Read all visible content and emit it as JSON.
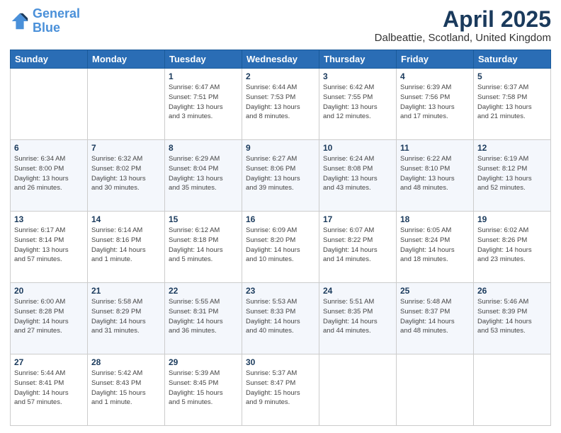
{
  "header": {
    "logo_line1": "General",
    "logo_line2": "Blue",
    "title": "April 2025",
    "subtitle": "Dalbeattie, Scotland, United Kingdom"
  },
  "days_of_week": [
    "Sunday",
    "Monday",
    "Tuesday",
    "Wednesday",
    "Thursday",
    "Friday",
    "Saturday"
  ],
  "weeks": [
    [
      {
        "num": "",
        "info": ""
      },
      {
        "num": "",
        "info": ""
      },
      {
        "num": "1",
        "info": "Sunrise: 6:47 AM\nSunset: 7:51 PM\nDaylight: 13 hours\nand 3 minutes."
      },
      {
        "num": "2",
        "info": "Sunrise: 6:44 AM\nSunset: 7:53 PM\nDaylight: 13 hours\nand 8 minutes."
      },
      {
        "num": "3",
        "info": "Sunrise: 6:42 AM\nSunset: 7:55 PM\nDaylight: 13 hours\nand 12 minutes."
      },
      {
        "num": "4",
        "info": "Sunrise: 6:39 AM\nSunset: 7:56 PM\nDaylight: 13 hours\nand 17 minutes."
      },
      {
        "num": "5",
        "info": "Sunrise: 6:37 AM\nSunset: 7:58 PM\nDaylight: 13 hours\nand 21 minutes."
      }
    ],
    [
      {
        "num": "6",
        "info": "Sunrise: 6:34 AM\nSunset: 8:00 PM\nDaylight: 13 hours\nand 26 minutes."
      },
      {
        "num": "7",
        "info": "Sunrise: 6:32 AM\nSunset: 8:02 PM\nDaylight: 13 hours\nand 30 minutes."
      },
      {
        "num": "8",
        "info": "Sunrise: 6:29 AM\nSunset: 8:04 PM\nDaylight: 13 hours\nand 35 minutes."
      },
      {
        "num": "9",
        "info": "Sunrise: 6:27 AM\nSunset: 8:06 PM\nDaylight: 13 hours\nand 39 minutes."
      },
      {
        "num": "10",
        "info": "Sunrise: 6:24 AM\nSunset: 8:08 PM\nDaylight: 13 hours\nand 43 minutes."
      },
      {
        "num": "11",
        "info": "Sunrise: 6:22 AM\nSunset: 8:10 PM\nDaylight: 13 hours\nand 48 minutes."
      },
      {
        "num": "12",
        "info": "Sunrise: 6:19 AM\nSunset: 8:12 PM\nDaylight: 13 hours\nand 52 minutes."
      }
    ],
    [
      {
        "num": "13",
        "info": "Sunrise: 6:17 AM\nSunset: 8:14 PM\nDaylight: 13 hours\nand 57 minutes."
      },
      {
        "num": "14",
        "info": "Sunrise: 6:14 AM\nSunset: 8:16 PM\nDaylight: 14 hours\nand 1 minute."
      },
      {
        "num": "15",
        "info": "Sunrise: 6:12 AM\nSunset: 8:18 PM\nDaylight: 14 hours\nand 5 minutes."
      },
      {
        "num": "16",
        "info": "Sunrise: 6:09 AM\nSunset: 8:20 PM\nDaylight: 14 hours\nand 10 minutes."
      },
      {
        "num": "17",
        "info": "Sunrise: 6:07 AM\nSunset: 8:22 PM\nDaylight: 14 hours\nand 14 minutes."
      },
      {
        "num": "18",
        "info": "Sunrise: 6:05 AM\nSunset: 8:24 PM\nDaylight: 14 hours\nand 18 minutes."
      },
      {
        "num": "19",
        "info": "Sunrise: 6:02 AM\nSunset: 8:26 PM\nDaylight: 14 hours\nand 23 minutes."
      }
    ],
    [
      {
        "num": "20",
        "info": "Sunrise: 6:00 AM\nSunset: 8:28 PM\nDaylight: 14 hours\nand 27 minutes."
      },
      {
        "num": "21",
        "info": "Sunrise: 5:58 AM\nSunset: 8:29 PM\nDaylight: 14 hours\nand 31 minutes."
      },
      {
        "num": "22",
        "info": "Sunrise: 5:55 AM\nSunset: 8:31 PM\nDaylight: 14 hours\nand 36 minutes."
      },
      {
        "num": "23",
        "info": "Sunrise: 5:53 AM\nSunset: 8:33 PM\nDaylight: 14 hours\nand 40 minutes."
      },
      {
        "num": "24",
        "info": "Sunrise: 5:51 AM\nSunset: 8:35 PM\nDaylight: 14 hours\nand 44 minutes."
      },
      {
        "num": "25",
        "info": "Sunrise: 5:48 AM\nSunset: 8:37 PM\nDaylight: 14 hours\nand 48 minutes."
      },
      {
        "num": "26",
        "info": "Sunrise: 5:46 AM\nSunset: 8:39 PM\nDaylight: 14 hours\nand 53 minutes."
      }
    ],
    [
      {
        "num": "27",
        "info": "Sunrise: 5:44 AM\nSunset: 8:41 PM\nDaylight: 14 hours\nand 57 minutes."
      },
      {
        "num": "28",
        "info": "Sunrise: 5:42 AM\nSunset: 8:43 PM\nDaylight: 15 hours\nand 1 minute."
      },
      {
        "num": "29",
        "info": "Sunrise: 5:39 AM\nSunset: 8:45 PM\nDaylight: 15 hours\nand 5 minutes."
      },
      {
        "num": "30",
        "info": "Sunrise: 5:37 AM\nSunset: 8:47 PM\nDaylight: 15 hours\nand 9 minutes."
      },
      {
        "num": "",
        "info": ""
      },
      {
        "num": "",
        "info": ""
      },
      {
        "num": "",
        "info": ""
      }
    ]
  ]
}
